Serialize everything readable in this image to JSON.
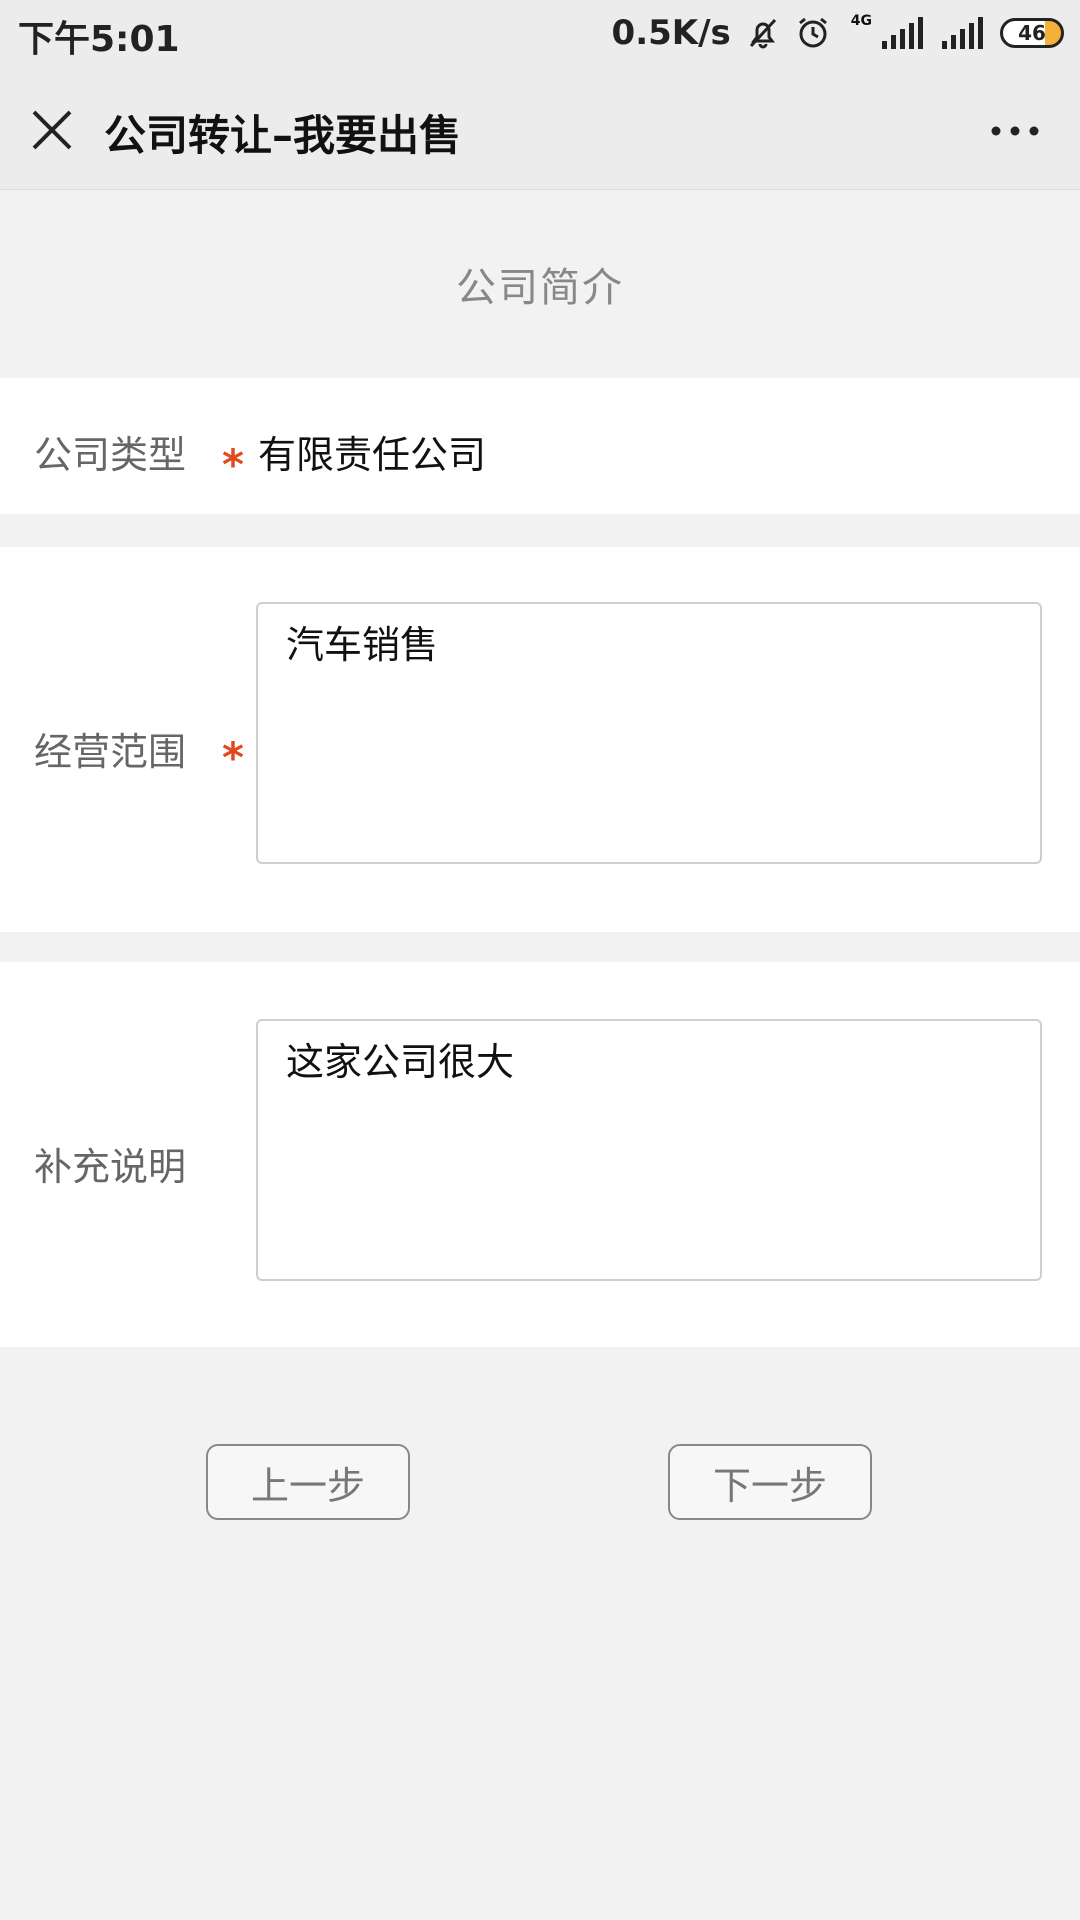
{
  "status_bar": {
    "time": "下午5:01",
    "net_speed": "0.5K/s",
    "network_type": "4G",
    "battery": "46",
    "icons": [
      "mute-bell-icon",
      "alarm-icon",
      "signal-icon",
      "signal-icon"
    ]
  },
  "titlebar": {
    "title": "公司转让–我要出售",
    "close_icon": "close-icon",
    "more_icon": "more-icon"
  },
  "section": {
    "title": "公司简介"
  },
  "form": {
    "company_type": {
      "label": "公司类型",
      "required_mark": "*",
      "value": "有限责任公司"
    },
    "business_scope": {
      "label": "经营范围",
      "required_mark": "*",
      "value": "汽车销售"
    },
    "supplement": {
      "label": "补充说明",
      "value": "这家公司很大"
    }
  },
  "buttons": {
    "prev": "上一步",
    "next": "下一步"
  },
  "colors": {
    "required": "#e04a1f",
    "background": "#f2f2f2",
    "battery_fill": "#f3b13b"
  }
}
